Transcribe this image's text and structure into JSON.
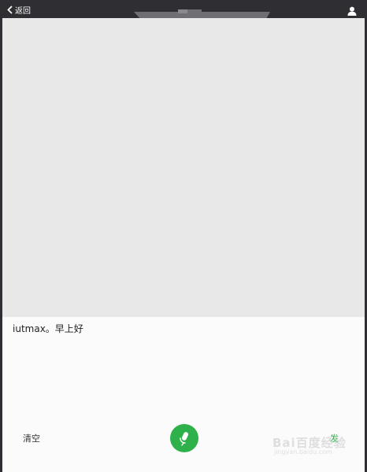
{
  "header": {
    "back_label": "返回",
    "back_icon": "chevron-left-icon",
    "user_icon": "user-icon"
  },
  "input": {
    "text": "iutmax。早上好"
  },
  "actions": {
    "clear_label": "清空",
    "mic_icon": "microphone-icon",
    "send_label": "发"
  },
  "watermark": {
    "main": "Bai百度经验",
    "sub": "jingyan.baidu.com"
  },
  "colors": {
    "topbar": "#2e2e33",
    "chat_bg": "#e8e8e8",
    "panel_bg": "#fbfbfb",
    "accent_green": "#2eb14a"
  }
}
